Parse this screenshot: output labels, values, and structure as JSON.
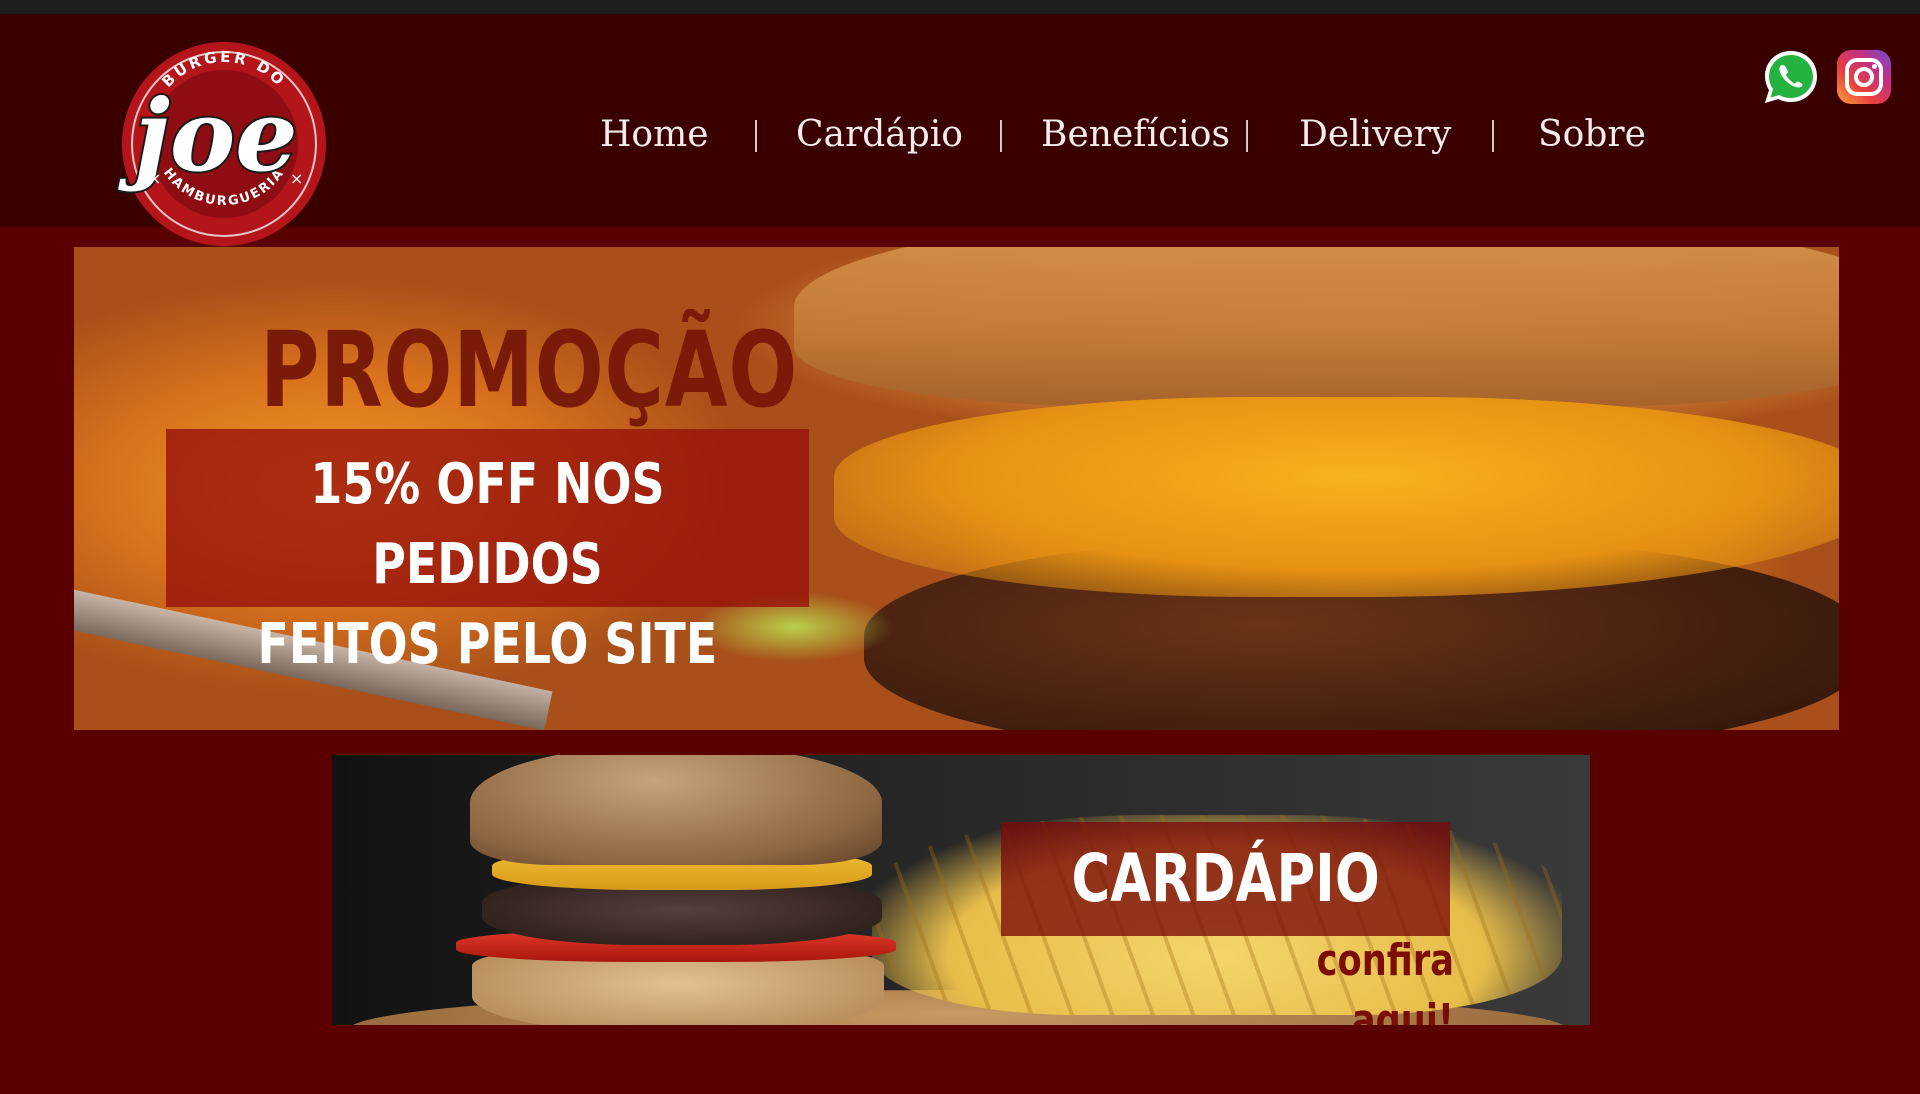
{
  "brand": {
    "top_text": "BURGER DO",
    "name": "joe",
    "bottom_text": "HAMBURGUERIA"
  },
  "nav": {
    "items": [
      {
        "label": "Home"
      },
      {
        "label": "Cardápio"
      },
      {
        "label": "Benefícios"
      },
      {
        "label": "Delivery"
      },
      {
        "label": "Sobre"
      }
    ]
  },
  "social": {
    "whatsapp_icon": "whatsapp-icon",
    "instagram_icon": "instagram-icon"
  },
  "promo": {
    "title": "PROMOÇÃO",
    "line1": "15% OFF NOS PEDIDOS",
    "line2": "FEITOS PELO SITE"
  },
  "menu_banner": {
    "title": "CARDÁPIO",
    "subtitle": "confira aqui!"
  },
  "colors": {
    "background": "#5a0000",
    "header": "#3a0000",
    "accent": "#c8191c"
  }
}
